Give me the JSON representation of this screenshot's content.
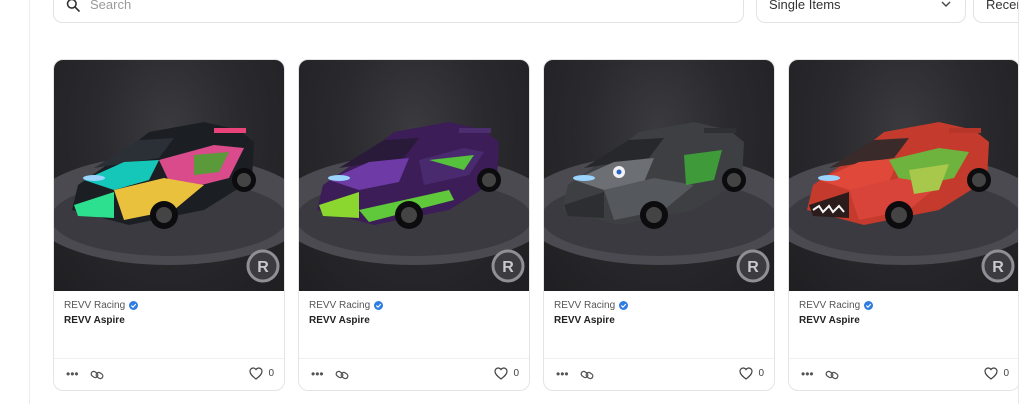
{
  "search": {
    "placeholder": "Search"
  },
  "filter": {
    "selected": "Single Items"
  },
  "sort": {
    "selected": "Recently"
  },
  "colors": {
    "verified": "#2f7de1",
    "card_bg": "#2a2a2e"
  },
  "cards": [
    {
      "collection": "REVV Racing",
      "name": "REVV Aspire",
      "likes": "0",
      "livery": "multicolor-graffiti"
    },
    {
      "collection": "REVV Racing",
      "name": "REVV Aspire",
      "likes": "0",
      "livery": "purple-poison"
    },
    {
      "collection": "REVV Racing",
      "name": "REVV Aspire",
      "likes": "0",
      "livery": "grey-monster"
    },
    {
      "collection": "REVV Racing",
      "name": "REVV Aspire",
      "likes": "0",
      "livery": "red-shark"
    }
  ]
}
